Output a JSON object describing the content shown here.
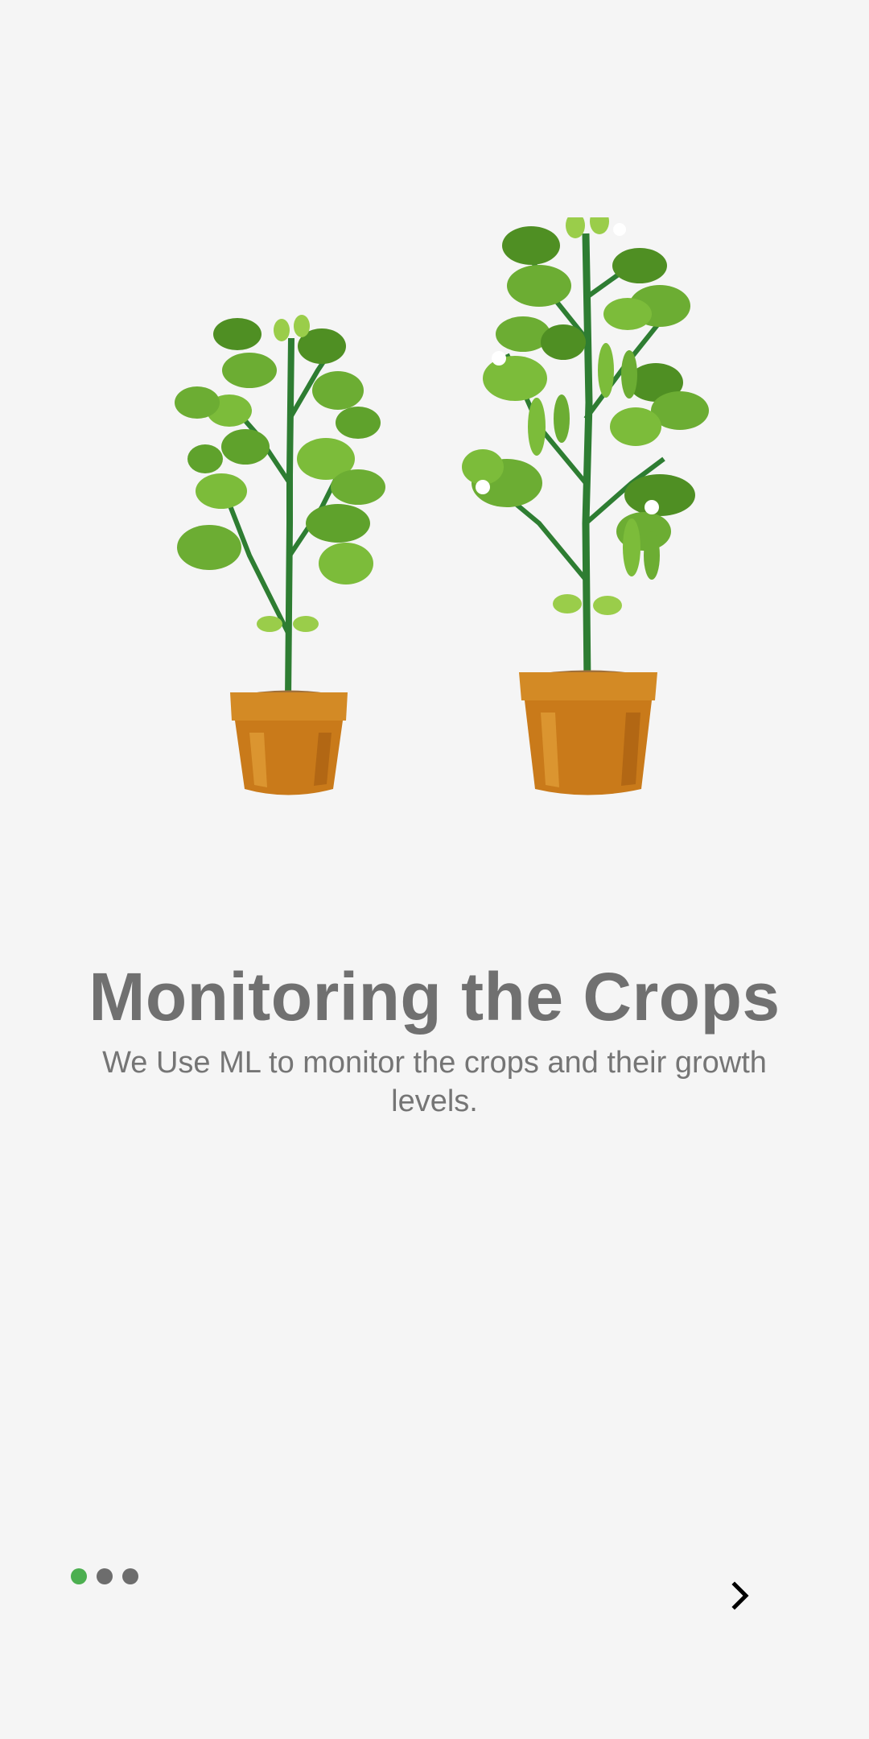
{
  "onboarding": {
    "title": "Monitoring the Crops",
    "subtitle": "We Use ML to monitor the crops and their growth levels.",
    "illustration_icon": "potted-plants-illustration",
    "pagination": {
      "total": 3,
      "active_index": 0
    },
    "next_icon": "chevron-right-icon"
  },
  "colors": {
    "background": "#f5f5f5",
    "text": "#707070",
    "active_dot": "#4caf50",
    "inactive_dot": "#6d6d6d"
  }
}
